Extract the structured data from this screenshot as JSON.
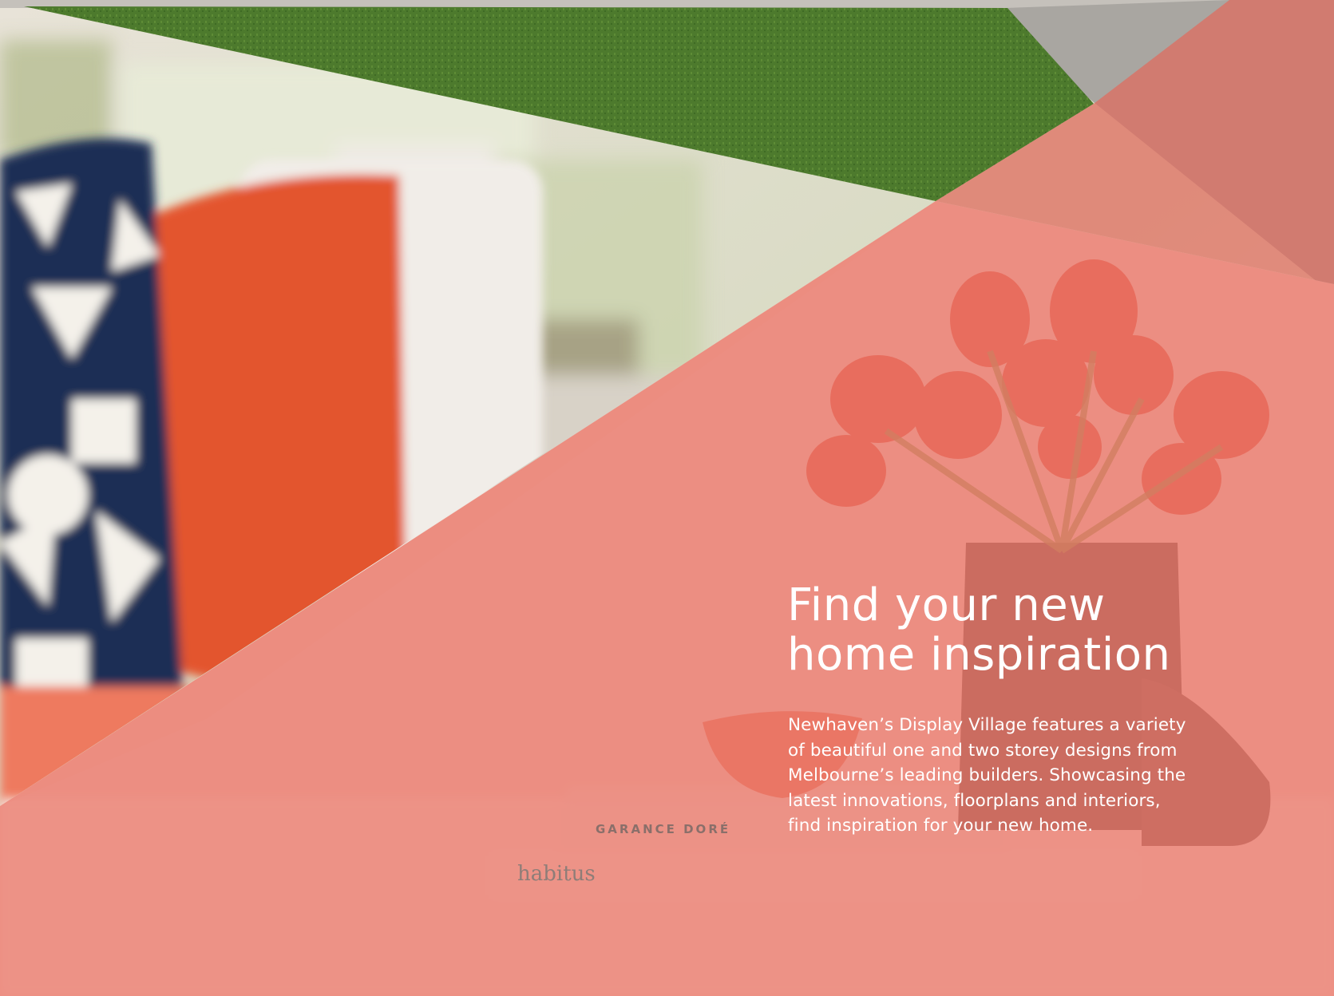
{
  "page": {
    "headline_lines": [
      "Find your new",
      "home inspiration"
    ],
    "body_lines": [
      "Newhaven’s Display Village features a variety",
      "of beautiful one and two storey designs from",
      "Melbourne’s leading builders. Showcasing the",
      "latest innovations, floorplans and interiors,",
      "find inspiration for your new home."
    ]
  },
  "photo": {
    "book_spine_1": "GARANCE DORÉ",
    "book_spine_2": "habitus"
  },
  "colors": {
    "coral_overlay": "#ea7a6c",
    "grass": "#4f7a2e",
    "pavement": "#a9a6a1",
    "cushion_orange": "#e2532d",
    "cushion_navy": "#1f2f55",
    "tulip": "#e0432f",
    "vase": "#5a3c3a"
  },
  "icons": {
    "decorative": [
      "geometric-triangle-overlay",
      "tulip-bouquet",
      "ceramic-vase",
      "stacked-books"
    ]
  }
}
